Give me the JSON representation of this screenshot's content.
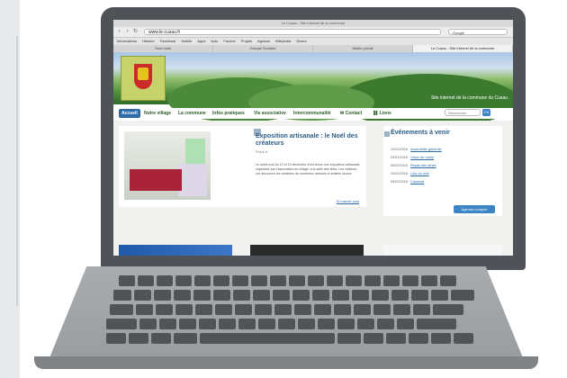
{
  "browser": {
    "window_title": "Le Cusau - Site internet de la commune",
    "url": "www.le-cusau.fr",
    "search_placeholder": "Google",
    "bookmarks": [
      "Informations",
      "Histoire",
      "Facebook",
      "Mobile",
      "Apps",
      "Actu",
      "Favoris",
      "Projets",
      "Agenda",
      "Wikipedia",
      "Divers"
    ],
    "tabs": [
      {
        "label": "Suivi colis"
      },
      {
        "label": "Groupe Scolaire"
      },
      {
        "label": "Mairie portail"
      },
      {
        "label": "Le Cusau - Site internet de la commune",
        "active": true
      }
    ]
  },
  "site": {
    "tagline": "Site internet de la commune du Cusau",
    "menu": {
      "items": [
        "Accueil",
        "Notre village",
        "La commune",
        "Infos pratiques",
        "Vie associative",
        "Intercommunalité",
        "Contact",
        "Liens"
      ],
      "search_placeholder": "Rechercher",
      "search_button": "OK"
    },
    "article": {
      "title": "Exposition artisanale : le Noël des créateurs",
      "date": "Publié le",
      "body": "Le week-end du 12 et 13 décembre s'est tenue une exposition artisanale organisée par l'association du village, à la salle des fêtes. Les visiteurs ont découvert les créations de nombreux artisans et artistes locaux.",
      "more": "En savoir plus"
    },
    "events": {
      "title": "Événements à venir",
      "items": [
        {
          "date": "12/01/2016",
          "label": "Assemblée générale"
        },
        {
          "date": "23/01/2016",
          "label": "Vœux du maire"
        },
        {
          "date": "06/02/2016",
          "label": "Repas des aînés"
        },
        {
          "date": "20/02/2016",
          "label": "Loto du club"
        },
        {
          "date": "05/03/2016",
          "label": "Carnaval"
        }
      ],
      "agenda_button": "Agenda complet"
    }
  },
  "icons": [
    "back-arrow-icon",
    "forward-arrow-icon",
    "reload-icon",
    "calendar-icon",
    "contact-icon",
    "links-icon"
  ]
}
